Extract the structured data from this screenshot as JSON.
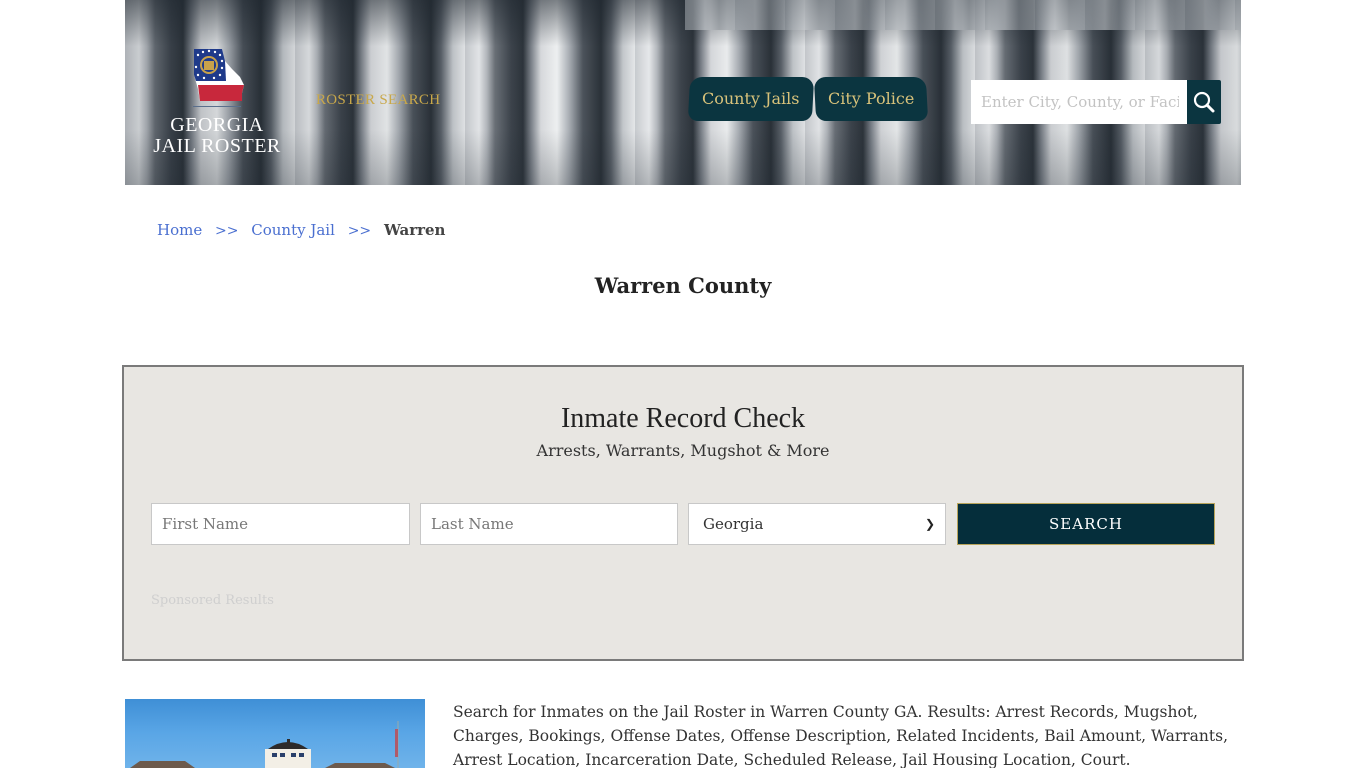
{
  "header": {
    "logo": {
      "line1": "GEORGIA",
      "line2": "JAIL ROSTER",
      "flag_colors": {
        "blue": "#1f3a8a",
        "red": "#c8283c",
        "white": "#ffffff",
        "gold": "#c9a24a"
      }
    },
    "roster_search_label": "ROSTER SEARCH",
    "nav": [
      {
        "label": "County Jails"
      },
      {
        "label": "City Police"
      }
    ],
    "search": {
      "placeholder": "Enter City, County, or Facil",
      "icon": "search-icon"
    }
  },
  "breadcrumb": {
    "items": [
      {
        "label": "Home"
      },
      {
        "label": "County Jail"
      },
      {
        "label": "Warren"
      }
    ],
    "separator": ">>"
  },
  "page": {
    "title": "Warren County"
  },
  "record_check": {
    "title": "Inmate Record Check",
    "subtitle": "Arrests, Warrants, Mugshot & More",
    "first_name_placeholder": "First Name",
    "last_name_placeholder": "Last Name",
    "state_selected": "Georgia",
    "search_button": "SEARCH",
    "sponsored_label": "Sponsored Results"
  },
  "content": {
    "description": "Search for Inmates on the Jail Roster in Warren County GA. Results: Arrest Records, Mugshot, Charges, Bookings, Offense Dates, Offense Description, Related Incidents, Bail Amount, Warrants, Arrest Location, Incarceration Date, Scheduled Release, Jail Housing Location, Court."
  },
  "colors": {
    "brand_dark": "#0b3540",
    "gold": "#d8c27a",
    "link": "#4a6fd0",
    "panel_bg": "#e8e6e2"
  }
}
